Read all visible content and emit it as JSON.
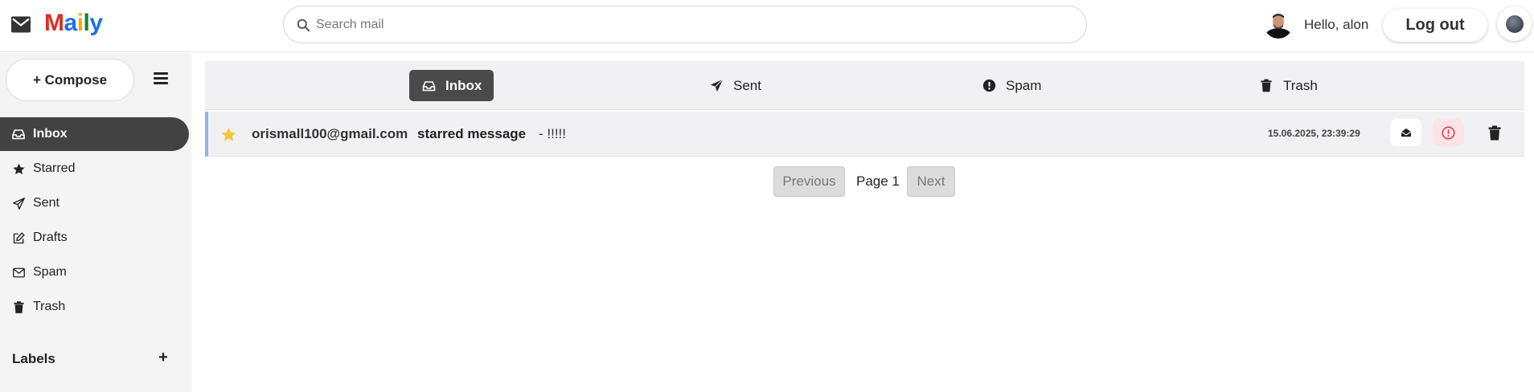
{
  "app": {
    "logo_letters": [
      "M",
      "a",
      "i",
      "l",
      "y"
    ],
    "logo_colors": [
      "#d93025",
      "#1a73e8",
      "#f9ab00",
      "#188038",
      "#1a73e8"
    ]
  },
  "header": {
    "search_placeholder": "Search mail",
    "greeting": "Hello, alon",
    "logout_label": "Log out"
  },
  "sidebar": {
    "compose_label": "+ Compose",
    "items": [
      {
        "label": "Inbox",
        "icon": "inbox-icon",
        "active": true
      },
      {
        "label": "Starred",
        "icon": "star-icon"
      },
      {
        "label": "Sent",
        "icon": "paper-plane-icon"
      },
      {
        "label": "Drafts",
        "icon": "edit-icon"
      },
      {
        "label": "Spam",
        "icon": "envelope-icon"
      },
      {
        "label": "Trash",
        "icon": "trash-icon"
      }
    ],
    "labels_title": "Labels",
    "labels_add": "+"
  },
  "tabs": [
    {
      "label": "Inbox",
      "icon": "inbox-icon",
      "active": true
    },
    {
      "label": "Sent",
      "icon": "paper-plane-icon"
    },
    {
      "label": "Spam",
      "icon": "exclamation-circle-icon"
    },
    {
      "label": "Trash",
      "icon": "trash-icon"
    }
  ],
  "mails": [
    {
      "starred": true,
      "sender": "orismall100@gmail.com",
      "subject": "starred message",
      "preview": "- !!!!!",
      "date": "15.06.2025, 23:39:29"
    }
  ],
  "pagination": {
    "previous_label": "Previous",
    "page_label": "Page 1",
    "next_label": "Next"
  },
  "colors": {
    "accent_dark": "#424242",
    "star": "#f4c542",
    "row_border": "#8fb4e8",
    "spam_bg": "#fbe3e6",
    "spam_icon": "#d8344a"
  }
}
